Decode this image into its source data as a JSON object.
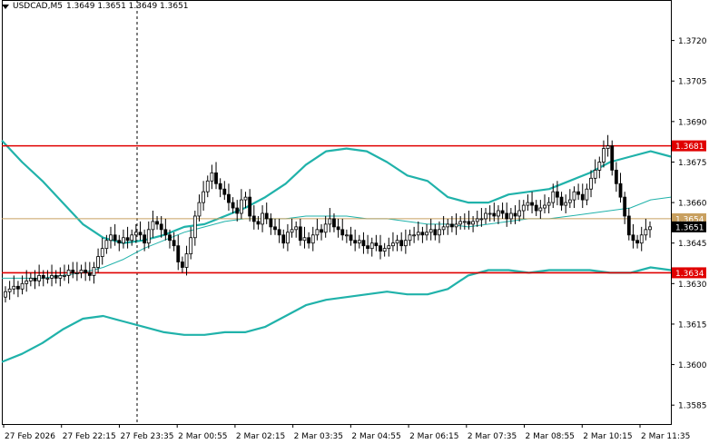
{
  "header": {
    "symbol": "USDCAD,M5",
    "ohlc": "1.3649 1.3651 1.3649 1.3651"
  },
  "colors": {
    "background": "#ffffff",
    "candle": "#000000",
    "bollinger": "#20b2aa",
    "level_line": "#e00000",
    "bid_line": "#c8a060",
    "price_badge": "#000000"
  },
  "chart_data": {
    "type": "candlestick",
    "symbol": "USDCAD",
    "timeframe": "M5",
    "ylim": [
      1.3578,
      1.3735
    ],
    "y_ticks": [
      "1.3720",
      "1.3705",
      "1.3690",
      "1.3675",
      "1.3660",
      "1.3645",
      "1.3630",
      "1.3615",
      "1.3600",
      "1.3585"
    ],
    "x_ticks": [
      "27 Feb 2026",
      "27 Feb 22:15",
      "27 Feb 23:35",
      "2 Mar 00:55",
      "2 Mar 02:15",
      "2 Mar 03:35",
      "2 Mar 04:55",
      "2 Mar 06:15",
      "2 Mar 07:35",
      "2 Mar 08:55",
      "2 Mar 10:15",
      "2 Mar 11:35"
    ],
    "levels": [
      {
        "value": 1.3681,
        "label": "1.3681"
      },
      {
        "value": 1.3634,
        "label": "1.3634"
      }
    ],
    "current_bid": {
      "value": 1.3654,
      "label": "1.3654"
    },
    "current_price": {
      "value": 1.3651,
      "label": "1.3651"
    },
    "close_series": [
      1.3627,
      1.3628,
      1.3629,
      1.3628,
      1.363,
      1.3631,
      1.3632,
      1.3631,
      1.3633,
      1.3632,
      1.3632,
      1.3633,
      1.3632,
      1.3633,
      1.3633,
      1.3635,
      1.3634,
      1.3634,
      1.3635,
      1.3634,
      1.3633,
      1.3636,
      1.364,
      1.3643,
      1.3646,
      1.3648,
      1.3646,
      1.3645,
      1.3647,
      1.3646,
      1.3648,
      1.3649,
      1.3648,
      1.3645,
      1.365,
      1.3653,
      1.3652,
      1.365,
      1.3648,
      1.3646,
      1.3644,
      1.3638,
      1.3636,
      1.3641,
      1.3647,
      1.3655,
      1.366,
      1.3664,
      1.3668,
      1.3671,
      1.3667,
      1.3665,
      1.3663,
      1.366,
      1.3658,
      1.3656,
      1.3661,
      1.3662,
      1.3655,
      1.3653,
      1.3652,
      1.3656,
      1.3654,
      1.3651,
      1.365,
      1.3648,
      1.3645,
      1.3649,
      1.365,
      1.3651,
      1.3646,
      1.3647,
      1.3645,
      1.3648,
      1.365,
      1.3649,
      1.3652,
      1.3654,
      1.3651,
      1.365,
      1.3648,
      1.3648,
      1.3646,
      1.3645,
      1.3646,
      1.3644,
      1.3643,
      1.3645,
      1.3644,
      1.3642,
      1.3643,
      1.3644,
      1.3645,
      1.3646,
      1.3644,
      1.3646,
      1.3648,
      1.3648,
      1.3649,
      1.3648,
      1.3649,
      1.365,
      1.3648,
      1.365,
      1.3651,
      1.3652,
      1.3651,
      1.3652,
      1.3653,
      1.3653,
      1.3652,
      1.3653,
      1.3654,
      1.3654,
      1.3656,
      1.3656,
      1.3655,
      1.3657,
      1.3656,
      1.3654,
      1.3656,
      1.3655,
      1.3657,
      1.3659,
      1.366,
      1.3659,
      1.3657,
      1.3658,
      1.3659,
      1.366,
      1.3664,
      1.3662,
      1.3659,
      1.366,
      1.3661,
      1.3664,
      1.3663,
      1.3661,
      1.3665,
      1.3669,
      1.3672,
      1.3675,
      1.368,
      1.3681,
      1.3672,
      1.3667,
      1.3662,
      1.3655,
      1.3648,
      1.3646,
      1.3645,
      1.3648,
      1.365,
      1.3651
    ],
    "bb_upper": [
      1.3683,
      1.3675,
      1.3668,
      1.366,
      1.3652,
      1.3647,
      1.3645,
      1.3646,
      1.3648,
      1.3651,
      1.3652,
      1.3655,
      1.3658,
      1.3662,
      1.3667,
      1.3674,
      1.3679,
      1.368,
      1.3679,
      1.3675,
      1.367,
      1.3668,
      1.3662,
      1.366,
      1.366,
      1.3663,
      1.3664,
      1.3665,
      1.3668,
      1.3671,
      1.3675,
      1.3677,
      1.3679,
      1.3677
    ],
    "bb_mid": [
      1.3632,
      1.3632,
      1.3632,
      1.3633,
      1.3634,
      1.3636,
      1.3639,
      1.3643,
      1.3646,
      1.3649,
      1.3651,
      1.3653,
      1.3654,
      1.3654,
      1.3654,
      1.3655,
      1.3655,
      1.3655,
      1.3654,
      1.3654,
      1.3653,
      1.3652,
      1.3652,
      1.3651,
      1.3652,
      1.3653,
      1.3654,
      1.3654,
      1.3655,
      1.3656,
      1.3657,
      1.3658,
      1.3661,
      1.3662
    ],
    "bb_lower": [
      1.3601,
      1.3604,
      1.3608,
      1.3613,
      1.3617,
      1.3618,
      1.3616,
      1.3614,
      1.3612,
      1.3611,
      1.3611,
      1.3612,
      1.3612,
      1.3614,
      1.3618,
      1.3622,
      1.3624,
      1.3625,
      1.3626,
      1.3627,
      1.3626,
      1.3626,
      1.3628,
      1.3633,
      1.3635,
      1.3635,
      1.3634,
      1.3635,
      1.3635,
      1.3635,
      1.3634,
      1.3634,
      1.3636,
      1.3635
    ]
  }
}
